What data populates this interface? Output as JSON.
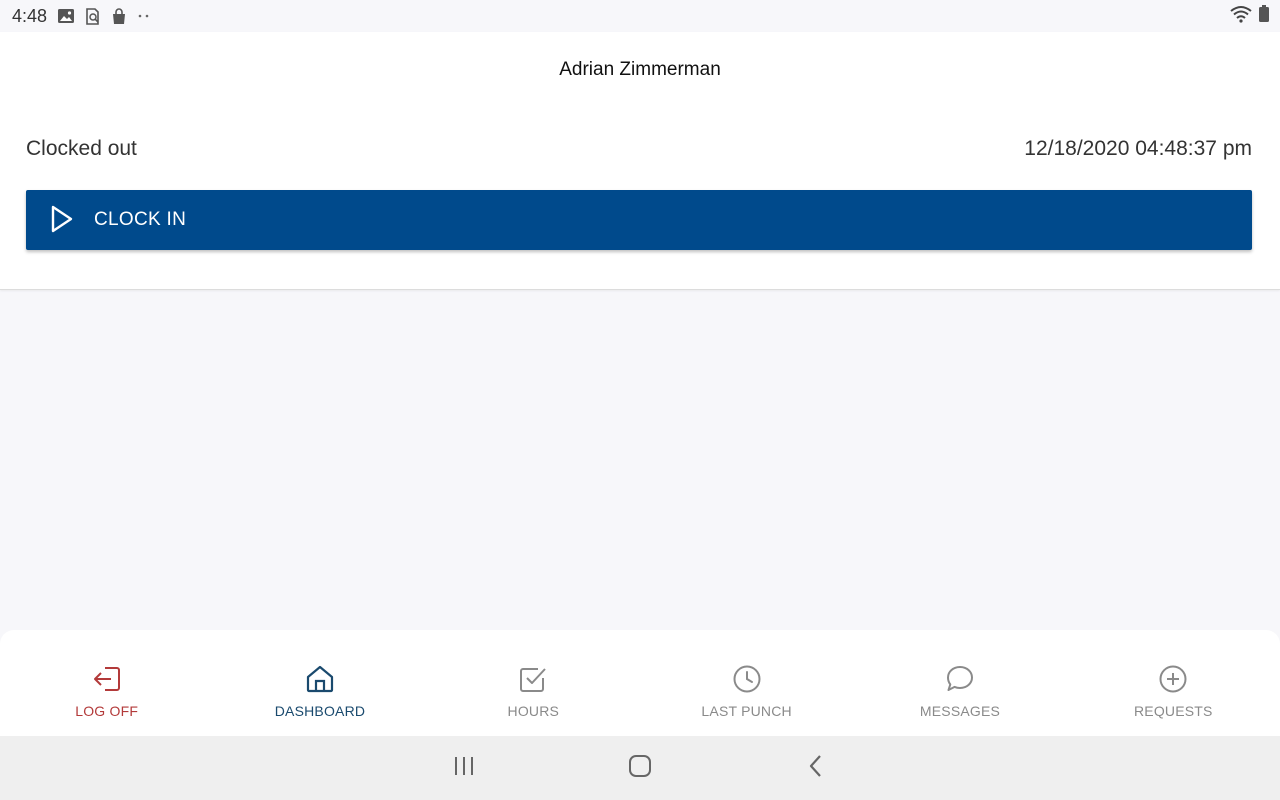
{
  "status_bar": {
    "time": "4:48",
    "icons": [
      "gallery-icon",
      "search-document-icon",
      "bag-icon",
      "more-dots-icon"
    ],
    "right_icons": [
      "wifi-icon",
      "battery-icon"
    ]
  },
  "header": {
    "user_name": "Adrian Zimmerman"
  },
  "clock": {
    "status": "Clocked out",
    "datetime": "12/18/2020 04:48:37 pm",
    "button_label": "CLOCK IN",
    "button_icon": "play-icon"
  },
  "bottom_nav": {
    "items": [
      {
        "label": "LOG OFF",
        "icon": "logout-icon"
      },
      {
        "label": "DASHBOARD",
        "icon": "home-icon"
      },
      {
        "label": "HOURS",
        "icon": "checkbox-icon"
      },
      {
        "label": "LAST PUNCH",
        "icon": "clock-icon"
      },
      {
        "label": "MESSAGES",
        "icon": "chat-bubble-icon"
      },
      {
        "label": "REQUESTS",
        "icon": "plus-circle-icon"
      }
    ],
    "active": "DASHBOARD"
  },
  "colors": {
    "primary": "#004a8c",
    "logoff": "#b33a3a",
    "active_nav": "#1a4a6e",
    "inactive_nav": "#8a8a8a",
    "background": "#f7f7fa"
  }
}
